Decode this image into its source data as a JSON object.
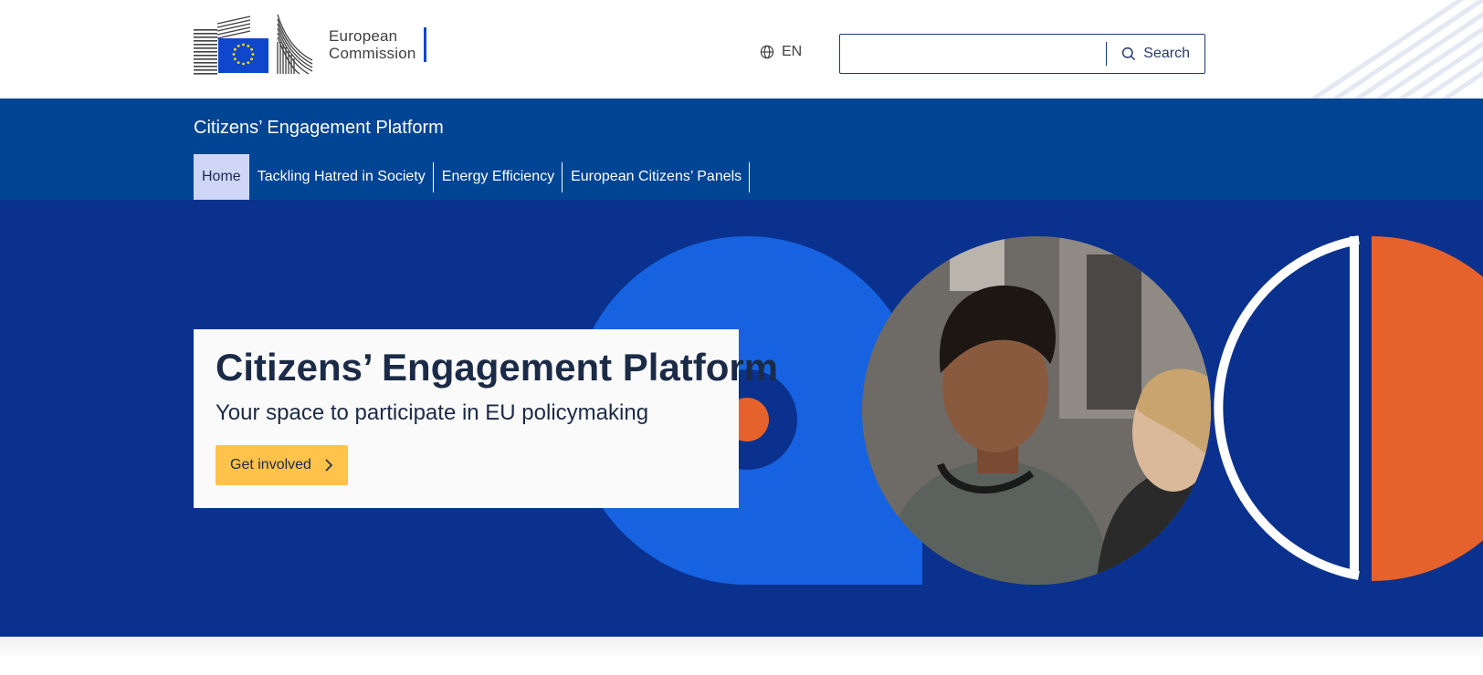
{
  "header": {
    "logo": {
      "line1": "European",
      "line2": "Commission"
    },
    "language": {
      "code": "EN",
      "icon": "globe-icon"
    },
    "search": {
      "value": "",
      "placeholder": "",
      "button_label": "Search",
      "icon": "search-icon"
    }
  },
  "site": {
    "name": "Citizens’ Engagement Platform",
    "menu": [
      {
        "label": "Home",
        "active": true
      },
      {
        "label": "Tackling Hatred in Society",
        "active": false
      },
      {
        "label": "Energy Efficiency",
        "active": false
      },
      {
        "label": "European Citizens’ Panels",
        "active": false
      }
    ]
  },
  "hero": {
    "title": "Citizens’ Engagement Platform",
    "subtitle": "Your space to participate in EU policymaking",
    "cta_label": "Get involved",
    "cta_icon": "chevron-right-icon"
  },
  "colors": {
    "header_bg": "#ffffff",
    "nav_band": "#004494",
    "hero_bg": "#0a318d",
    "active_tab": "#cfd6f5",
    "circle_blue": "#1662e0",
    "accent_orange": "#e6622c",
    "cta_yellow": "#ffc24b",
    "logo_bar": "#0e47cb"
  }
}
